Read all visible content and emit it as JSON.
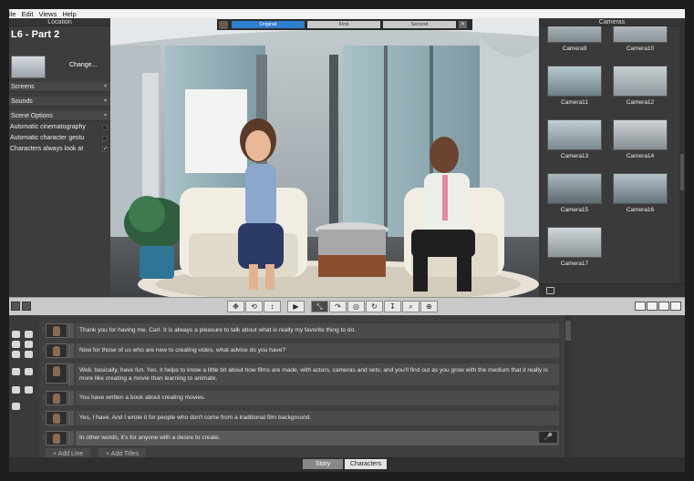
{
  "menu": [
    "ile",
    "Edit",
    "Views",
    "Help"
  ],
  "left_panel": {
    "header": "Location",
    "scene_title": "L6 - Part 2",
    "change_label": "Change...",
    "rows": [
      "Screens",
      "Sounds",
      "Scene Options"
    ],
    "options": [
      {
        "label": "Automatic cinematography",
        "checked": false
      },
      {
        "label": "Automatic character gestu",
        "checked": false
      },
      {
        "label": "Characters always look at",
        "checked": true
      }
    ]
  },
  "compare_bar": {
    "buttons": [
      "Original",
      "First",
      "Second"
    ],
    "active": "Original",
    "close": "✕"
  },
  "cameras": {
    "header": "Cameras",
    "items": [
      "Camera9",
      "Camera10",
      "Camera11",
      "Camera12",
      "Camera13",
      "Camera14",
      "Camera15",
      "Camera16",
      "Camera17"
    ]
  },
  "toolbar": {
    "play_glyph": "▶"
  },
  "story": {
    "lines": [
      {
        "text": "Thank you for having me, Carl. It is always a pleasure to talk about what is really my favorite thing to do."
      },
      {
        "text": "Now for those of us who are new to creating video, what advice do you have?"
      },
      {
        "text": "Well, basically, have fun. Yes, it helps to know a little bit about how films are made, with actors, cameras and sets; and you'll find out as you grow with the medium that it really is more like creating a movie than learning to animate."
      },
      {
        "text": "You have written a book about creating movies."
      },
      {
        "text": "Yes, I have. And I wrote it for people who don't come from a traditional film background."
      },
      {
        "text": "In other words, it's for anyone with a desire to create."
      }
    ],
    "add_line": "+ Add Line",
    "add_titles": "+ Add Titles",
    "mic_glyph": "🎤"
  },
  "tabs": {
    "story": "Story",
    "characters": "Characters"
  }
}
